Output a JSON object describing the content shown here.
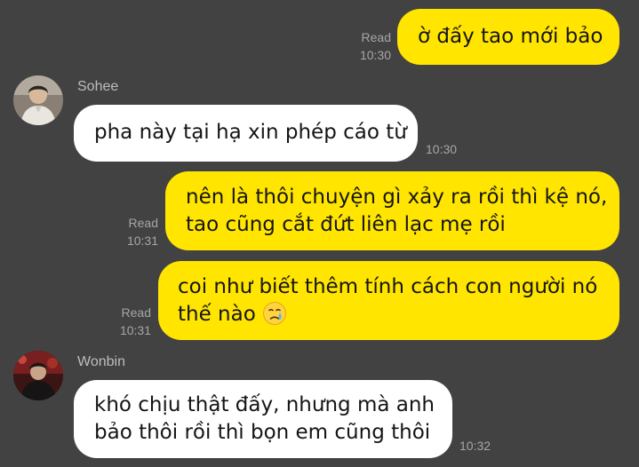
{
  "messages": [
    {
      "side": "out",
      "lines": [
        "ờ đấy tao mới bảo"
      ],
      "read": "Read",
      "time": "10:30"
    },
    {
      "side": "in",
      "sender": "Sohee",
      "lines": [
        "pha này tại hạ xin phép cáo từ"
      ],
      "time": "10:30"
    },
    {
      "side": "out",
      "lines": [
        "nên là thôi chuyện gì xảy ra rồi thì kệ nó,",
        "tao cũng cắt đứt liên lạc mẹ rồi"
      ],
      "read": "Read",
      "time": "10:31"
    },
    {
      "side": "out",
      "lines": [
        "coi như biết thêm tính cách con người nó",
        "thế nào"
      ],
      "emoji": "crying-face-icon",
      "read": "Read",
      "time": "10:31"
    },
    {
      "side": "in",
      "sender": "Wonbin",
      "lines": [
        "khó chịu thật đấy, nhưng mà anh",
        "bảo thôi rồi thì bọn em cũng thôi"
      ],
      "time": "10:32"
    }
  ],
  "colors": {
    "background": "#424242",
    "outgoing_bubble": "#ffe500",
    "incoming_bubble": "#ffffff",
    "meta_text": "#a6a6a6",
    "sender_name": "#bdbdbd"
  }
}
